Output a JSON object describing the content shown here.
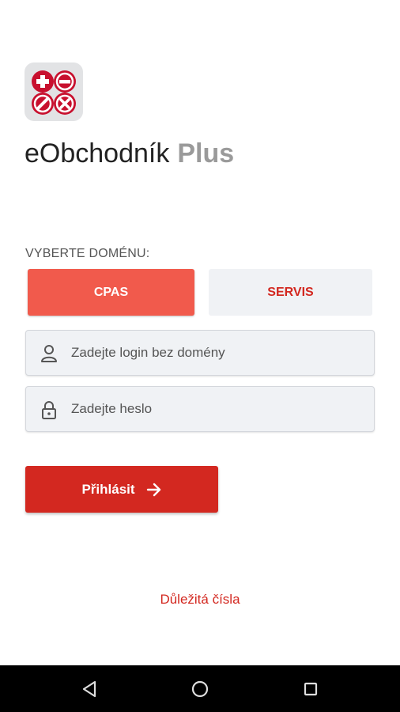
{
  "app": {
    "name": "eObchodník",
    "name_suffix": "Plus",
    "logo_icon": "calculator-operators-icon",
    "accent_color": "#d32820",
    "selected_color": "#f15a4c"
  },
  "domain": {
    "label": "VYBERTE DOMÉNU:",
    "options": [
      {
        "label": "CPAS",
        "selected": true
      },
      {
        "label": "SERVIS",
        "selected": false
      }
    ]
  },
  "form": {
    "login": {
      "icon": "user-icon",
      "placeholder": "Zadejte login bez domény",
      "value": ""
    },
    "password": {
      "icon": "lock-icon",
      "placeholder": "Zadejte heslo",
      "value": ""
    },
    "submit_label": "Přihlásit",
    "submit_icon": "arrow-right-icon"
  },
  "links": {
    "important_numbers": "Důležitá čísla"
  },
  "navbar": {
    "icons": [
      "back-icon",
      "home-icon",
      "recents-icon"
    ]
  }
}
